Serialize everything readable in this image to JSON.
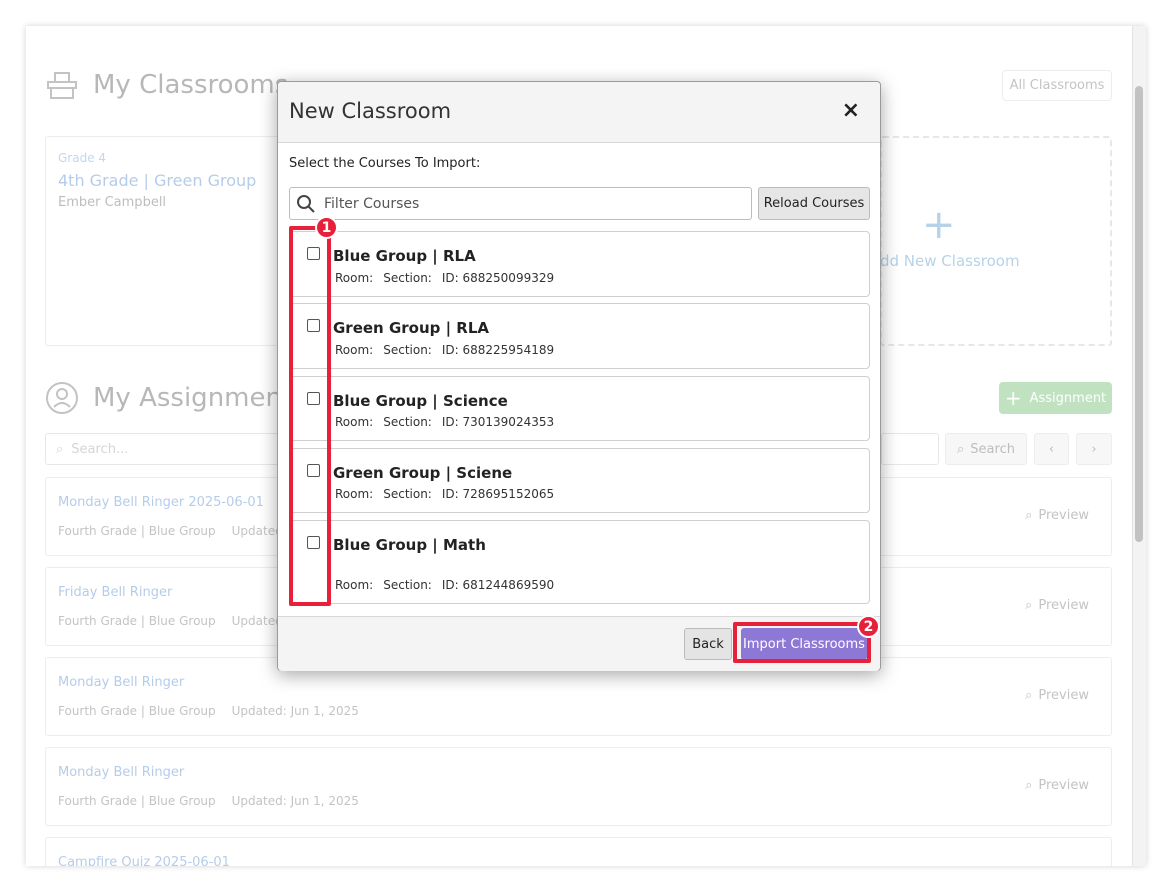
{
  "background": {
    "classrooms_title": "My Classrooms",
    "all_classrooms_label": "All Classrooms",
    "classroom_card": {
      "grade": "Grade 4",
      "name": "4th Grade | Green Group",
      "teacher": "Ember Campbell"
    },
    "add_classroom_label": "dd New Classroom",
    "assignments_title": "My Assignment",
    "add_assignment_label": "Assignment",
    "search_placeholder": "Search...",
    "search_button": "Search",
    "assignments": [
      {
        "title": "Monday Bell Ringer 2025-06-01",
        "group": "Fourth Grade | Blue Group",
        "updated": "Updated: Ju",
        "preview": "Preview"
      },
      {
        "title": "Friday Bell Ringer",
        "group": "Fourth Grade | Blue Group",
        "updated": "Updated: Ju",
        "preview": "Preview"
      },
      {
        "title": "Monday Bell Ringer",
        "group": "Fourth Grade | Blue Group",
        "updated": "Updated: Jun 1, 2025",
        "preview": "Preview"
      },
      {
        "title": "Monday Bell Ringer",
        "group": "Fourth Grade | Blue Group",
        "updated": "Updated: Jun 1, 2025",
        "preview": "Preview"
      },
      {
        "title": "Campfire Quiz 2025-06-01",
        "group": "",
        "updated": "",
        "preview": ""
      }
    ]
  },
  "modal": {
    "title": "New Classroom",
    "close_label": "×",
    "subtitle": "Select the Courses To Import:",
    "filter_placeholder": "Filter Courses",
    "reload_label": "Reload Courses",
    "courses": [
      {
        "name": "Blue Group | RLA",
        "room": "Room:",
        "section": "Section:",
        "id": "ID: 688250099329"
      },
      {
        "name": "Green Group | RLA",
        "room": "Room:",
        "section": "Section:",
        "id": "ID: 688225954189"
      },
      {
        "name": "Blue Group | Science",
        "room": "Room:",
        "section": "Section:",
        "id": "ID: 730139024353"
      },
      {
        "name": "Green Group | Sciene",
        "room": "Room:",
        "section": "Section:",
        "id": "ID: 728695152065"
      },
      {
        "name": "Blue Group | Math",
        "room": "Room:",
        "section": "Section:",
        "id": "ID: 681244869590"
      }
    ],
    "back_label": "Back",
    "import_label": "Import Classrooms"
  },
  "annotations": {
    "badge_1": "1",
    "badge_2": "2"
  },
  "colors": {
    "annotation_red": "#e8213a",
    "import_purple": "#8e78d6",
    "link_blue": "#2f6fc0"
  }
}
